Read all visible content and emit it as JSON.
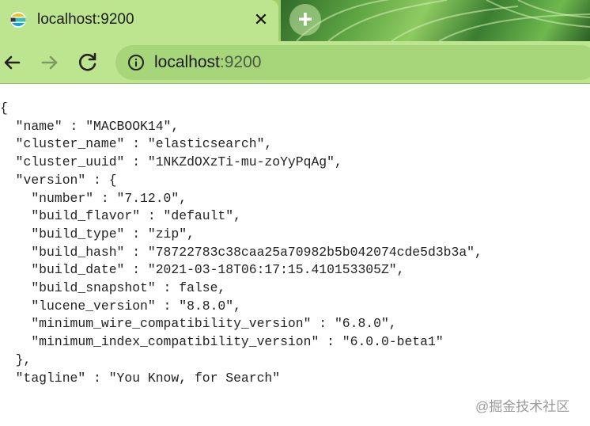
{
  "tab": {
    "title": "localhost:9200",
    "close_label": "✕",
    "new_tab_label": "+"
  },
  "omnibox": {
    "host": "localhost",
    "port": ":9200"
  },
  "response_lines": [
    "{",
    "  \"name\" : \"MACBOOK14\",",
    "  \"cluster_name\" : \"elasticsearch\",",
    "  \"cluster_uuid\" : \"1NKZdOXzTi-mu-zoYyPqAg\",",
    "  \"version\" : {",
    "    \"number\" : \"7.12.0\",",
    "    \"build_flavor\" : \"default\",",
    "    \"build_type\" : \"zip\",",
    "    \"build_hash\" : \"78722783c38caa25a70982b5b042074cde5d3b3a\",",
    "    \"build_date\" : \"2021-03-18T06:17:15.410153305Z\",",
    "    \"build_snapshot\" : false,",
    "    \"lucene_version\" : \"8.8.0\",",
    "    \"minimum_wire_compatibility_version\" : \"6.8.0\",",
    "    \"minimum_index_compatibility_version\" : \"6.0.0-beta1\"",
    "  },",
    "  \"tagline\" : \"You Know, for Search\""
  ],
  "watermark": "@掘金技术社区",
  "colors": {
    "tab_active": "#bde58f",
    "toolbar": "#bde58f",
    "omnibox": "#a6d57a",
    "tabstrip": "#9fce6c"
  },
  "icons": {
    "favicon": "elasticsearch-logo-icon",
    "back": "arrow-left-icon",
    "forward": "arrow-right-icon",
    "reload": "reload-icon",
    "site_info": "info-circle-icon",
    "close": "close-icon",
    "new_tab": "plus-icon"
  }
}
